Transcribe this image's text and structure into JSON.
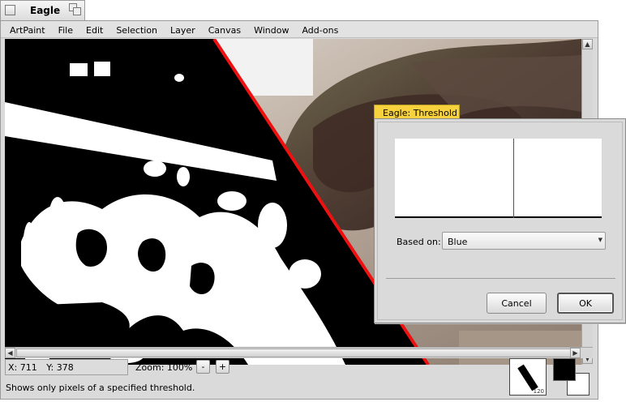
{
  "window": {
    "title": "Eagle"
  },
  "menu": [
    "ArtPaint",
    "File",
    "Edit",
    "Selection",
    "Layer",
    "Canvas",
    "Window",
    "Add-ons"
  ],
  "status": {
    "x": "X: 711",
    "y": "Y: 378",
    "zoom_label": "Zoom: 100%",
    "zoom_out": "-",
    "zoom_in": "+",
    "help_text": "Shows only pixels of a specified threshold."
  },
  "brush": {
    "size": "120"
  },
  "colors": {
    "foreground": "#000000",
    "background": "#ffffff",
    "divider_line": "#ee1111",
    "dialog_tab": "#f7d23e"
  },
  "dialog": {
    "title": "Eagle: Threshold",
    "based_on_label": "Based on:",
    "based_on_value": "Blue",
    "cancel_label": "Cancel",
    "ok_label": "OK"
  },
  "icons": {
    "window_close": "close-box-icon",
    "window_zoom": "zoom-box-icon",
    "scroll_left": "arrow-left-icon",
    "scroll_right": "arrow-right-icon",
    "scroll_up": "arrow-up-icon",
    "scroll_down": "arrow-down-icon",
    "brush": "brush-stroke-icon",
    "select_arrow": "dropdown-arrow-icon"
  }
}
